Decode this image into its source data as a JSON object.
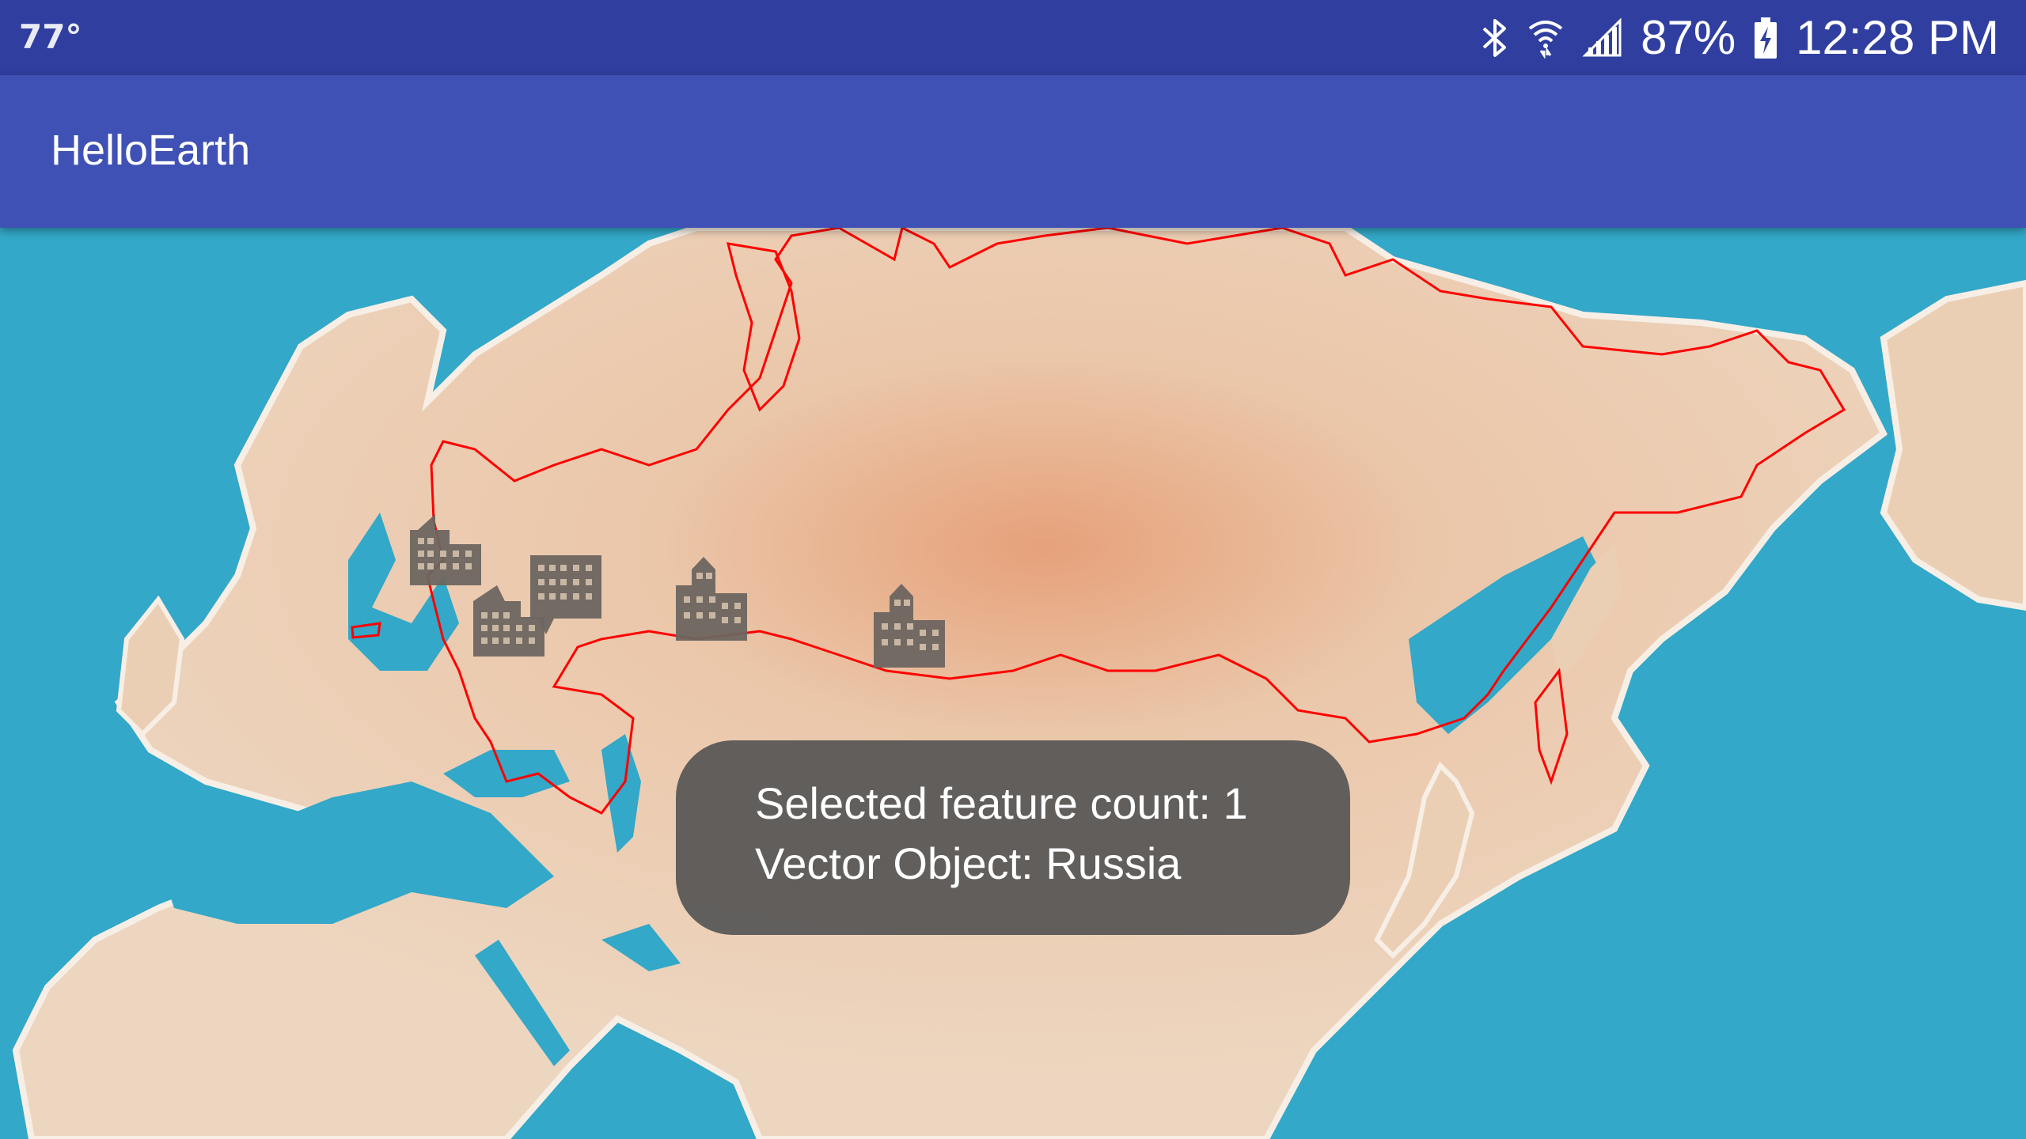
{
  "status_bar": {
    "temperature": "77°",
    "battery_percent": "87%",
    "time": "12:28 PM",
    "icons": [
      "bluetooth-icon",
      "wifi-icon",
      "signal-icon",
      "battery-charging-icon"
    ]
  },
  "app_bar": {
    "title": "HelloEarth"
  },
  "map": {
    "selected_country": "Russia",
    "marker_icon": "building-icon",
    "marker_count": 5,
    "colors": {
      "ocean": "#33a8c8",
      "land": "#e8c9ad",
      "border": "#ff0000",
      "marker": "#6d6560"
    }
  },
  "toast": {
    "line1": "Selected feature count: 1",
    "line2": "Vector Object: Russia"
  }
}
